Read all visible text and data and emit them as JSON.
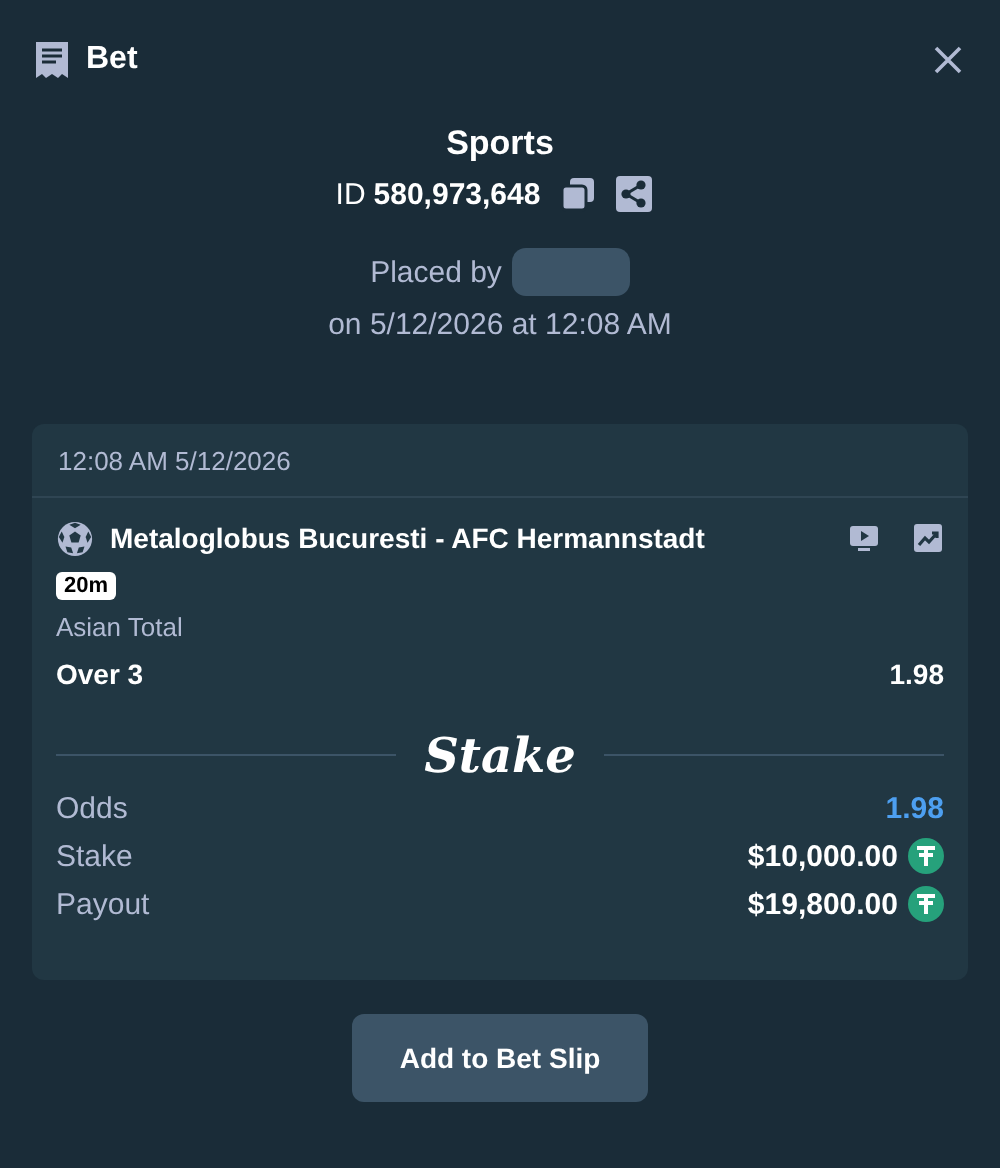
{
  "header": {
    "title": "Bet"
  },
  "summary": {
    "title": "Sports",
    "id_label": "ID",
    "id_value": "580,973,648",
    "placed_by": "Placed by",
    "placed_on": "on 5/12/2026 at 12:08 AM"
  },
  "card": {
    "timestamp": "12:08 AM 5/12/2026",
    "match": "Metaloglobus Bucuresti - AFC Hermannstadt",
    "time_badge": "20m",
    "market": "Asian Total",
    "selection": "Over 3",
    "selection_odds": "1.98",
    "logo": "Stake",
    "rows": [
      {
        "label": "Odds",
        "value": "1.98",
        "kind": "odds"
      },
      {
        "label": "Stake",
        "value": "$10,000.00",
        "kind": "amount"
      },
      {
        "label": "Payout",
        "value": "$19,800.00",
        "kind": "amount"
      }
    ]
  },
  "button": "Add to Bet Slip"
}
